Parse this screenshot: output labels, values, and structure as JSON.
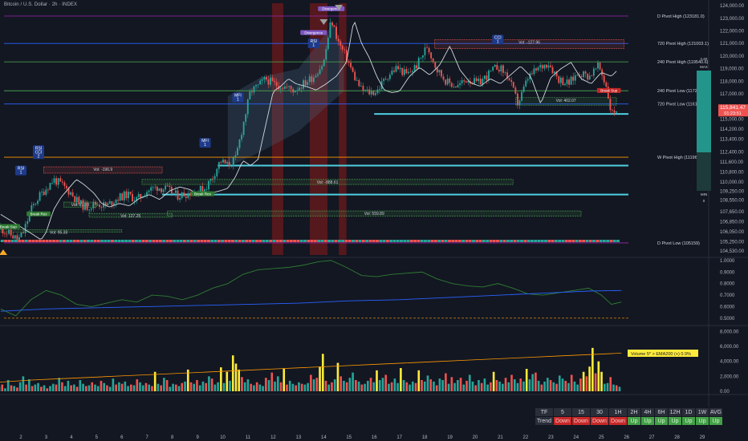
{
  "header": {
    "title": "Bitcoin / U.S. Dollar · 2h · INDEX"
  },
  "chart_data": [
    {
      "type": "candlestick",
      "panel": "price",
      "ylim": [
        104200,
        124200
      ],
      "y_ticks": [
        124000,
        123000,
        122000,
        121000,
        120000,
        119000,
        118000,
        117000,
        116000,
        115000,
        114200,
        113400,
        112400,
        111600,
        110800,
        110000,
        109250,
        108550,
        107650,
        106850,
        106050,
        105250,
        104530
      ],
      "y_tick_labels": [
        "124,000.00",
        "123,000.00",
        "122,000.00",
        "121,000.00",
        "120,000.00",
        "119,000.00",
        "118,000.00",
        "117,000.00",
        "116,000.00",
        "115,000.00",
        "114,200.00",
        "113,400.00",
        "112,400.00",
        "111,600.00",
        "110,800.00",
        "110,000.00",
        "109,250.00",
        "108,550.00",
        "107,650.00",
        "106,850.00",
        "106,050.00",
        "105,250.00",
        "104,530.00"
      ],
      "x_ticks": [
        2,
        3,
        4,
        5,
        6,
        7,
        8,
        9,
        10,
        11,
        12,
        13,
        14,
        15,
        16,
        17,
        18,
        19,
        20,
        21,
        22,
        23,
        24,
        25,
        26,
        27,
        28,
        29
      ],
      "x_tick_labels": [
        "2",
        "3",
        "4",
        "5",
        "6",
        "7",
        "8",
        "9",
        "10",
        "11",
        "12",
        "13",
        "14",
        "15",
        "16",
        "17",
        "18",
        "19",
        "20",
        "21",
        "22",
        "23",
        "24",
        "25",
        "26",
        "27",
        "28",
        "29"
      ],
      "close_path": [
        [
          1.2,
          106300
        ],
        [
          1.6,
          105800
        ],
        [
          1.9,
          105400
        ],
        [
          2.1,
          106000
        ],
        [
          2.4,
          107800
        ],
        [
          2.7,
          108800
        ],
        [
          3.0,
          109500
        ],
        [
          3.3,
          110200
        ],
        [
          3.6,
          109800
        ],
        [
          4.0,
          109100
        ],
        [
          4.3,
          108300
        ],
        [
          4.6,
          108000
        ],
        [
          5.0,
          108300
        ],
        [
          5.4,
          108100
        ],
        [
          5.8,
          108700
        ],
        [
          6.2,
          109000
        ],
        [
          6.6,
          108600
        ],
        [
          7.0,
          109300
        ],
        [
          7.4,
          109600
        ],
        [
          7.8,
          109400
        ],
        [
          8.2,
          108900
        ],
        [
          8.6,
          109100
        ],
        [
          9.0,
          109300
        ],
        [
          9.3,
          109500
        ],
        [
          9.6,
          110400
        ],
        [
          9.9,
          111700
        ],
        [
          10.2,
          111300
        ],
        [
          10.5,
          111800
        ],
        [
          10.8,
          114500
        ],
        [
          11.1,
          117200
        ],
        [
          11.4,
          117600
        ],
        [
          11.7,
          118200
        ],
        [
          12.0,
          117800
        ],
        [
          12.4,
          117600
        ],
        [
          12.8,
          117300
        ],
        [
          13.2,
          117800
        ],
        [
          13.6,
          118400
        ],
        [
          14.0,
          119500
        ],
        [
          14.3,
          122900
        ],
        [
          14.6,
          121000
        ],
        [
          14.9,
          119900
        ],
        [
          15.2,
          118400
        ],
        [
          15.5,
          117300
        ],
        [
          15.8,
          117100
        ],
        [
          16.1,
          117200
        ],
        [
          16.5,
          118400
        ],
        [
          16.9,
          119100
        ],
        [
          17.3,
          118500
        ],
        [
          17.7,
          119300
        ],
        [
          18.1,
          120800
        ],
        [
          18.5,
          118900
        ],
        [
          18.9,
          117900
        ],
        [
          19.3,
          117600
        ],
        [
          19.7,
          118200
        ],
        [
          20.1,
          117800
        ],
        [
          20.5,
          118500
        ],
        [
          20.9,
          119200
        ],
        [
          21.3,
          118400
        ],
        [
          21.7,
          116200
        ],
        [
          22.1,
          118300
        ],
        [
          22.5,
          119000
        ],
        [
          22.9,
          119500
        ],
        [
          23.3,
          118200
        ],
        [
          23.7,
          117800
        ],
        [
          24.1,
          118700
        ],
        [
          24.5,
          118400
        ],
        [
          24.9,
          119200
        ],
        [
          25.2,
          117600
        ],
        [
          25.4,
          115400
        ],
        [
          25.6,
          115800
        ]
      ],
      "last_price": 115841.47,
      "countdown": "01:23:51",
      "levels": [
        {
          "price": 123181.0,
          "label": "D Pivot High (123181.0)",
          "color": "#9c27b0"
        },
        {
          "price": 121003.1,
          "label": "720 Pivot High (121003.1)",
          "color": "#2962ff"
        },
        {
          "price": 119540.6,
          "label": "240 Pivot High (119540.6)",
          "color": "#4caf50"
        },
        {
          "price": 117246.9,
          "label": "240 Pivot Low (117246.9)",
          "color": "#4caf50"
        },
        {
          "price": 116195.3,
          "label": "720 Pivot Low (116195.3)",
          "color": "#2962ff"
        },
        {
          "price": 111965.8,
          "label": "W Pivot High (111965.8)",
          "color": "#ff9800"
        },
        {
          "price": 105159.0,
          "label": "D Pivot Low (105159)",
          "color": "#9c27b0"
        }
      ],
      "cyan_lines": [
        111300,
        109000,
        115400
      ],
      "volume_boxes": [
        {
          "label": "Vol: -127.96",
          "color": "#ef5350"
        },
        {
          "label": "Vol: 402.07",
          "color": "#4caf50"
        },
        {
          "label": "Vol: -196.9",
          "color": "#ef5350"
        },
        {
          "label": "Vol: -888.61",
          "color": "#4caf50"
        },
        {
          "label": "Vol: 127.25",
          "color": "#4caf50"
        },
        {
          "label": "Vol: 559.89",
          "color": "#4caf50"
        },
        {
          "label": "Vol: 97.58",
          "color": "#4caf50"
        },
        {
          "label": "Vol: 95.33",
          "color": "#4caf50"
        }
      ],
      "signals": [
        {
          "x": 2.0,
          "price": 110400,
          "label": "RSI\n1",
          "color": "#1e3a8a"
        },
        {
          "x": 2.7,
          "price": 111700,
          "label": "RSI\nCCI\n2",
          "color": "#1e3a8a"
        },
        {
          "x": 10.6,
          "price": 116200,
          "label": "MFI\n1",
          "color": "#1e3a8a"
        },
        {
          "x": 9.3,
          "price": 112600,
          "label": "MFI\n1",
          "color": "#1e3a8a"
        },
        {
          "x": 13.6,
          "price": 120500,
          "label": "RSI\n1",
          "color": "#1e3a8a"
        },
        {
          "x": 20.9,
          "price": 120800,
          "label": "CCI\n1",
          "color": "#1e3a8a"
        }
      ],
      "tags": [
        "Break Sup",
        "Break Res",
        "Break Res",
        "Break Sup",
        "Divergence",
        "Divergence"
      ],
      "side_labels": {
        "max": "MAX",
        "min": "MIN",
        "zero": "0",
        "max_value": "4.4K"
      }
    },
    {
      "type": "line",
      "panel": "oscillator",
      "ylim": [
        0.45,
        1.02
      ],
      "y_ticks": [
        1.0,
        0.9,
        0.8,
        0.7,
        0.6,
        0.5
      ],
      "y_tick_labels": [
        "1.0000",
        "0.9000",
        "0.8000",
        "0.7000",
        "0.6000",
        "0.5000"
      ],
      "series": [
        {
          "color": "#2e7d32",
          "values": [
            [
              1.2,
              0.58
            ],
            [
              1.8,
              0.52
            ],
            [
              2.4,
              0.66
            ],
            [
              3.0,
              0.74
            ],
            [
              3.6,
              0.7
            ],
            [
              4.2,
              0.62
            ],
            [
              4.8,
              0.6
            ],
            [
              5.4,
              0.63
            ],
            [
              6.0,
              0.66
            ],
            [
              6.6,
              0.64
            ],
            [
              7.2,
              0.7
            ],
            [
              7.8,
              0.69
            ],
            [
              8.4,
              0.66
            ],
            [
              9.0,
              0.7
            ],
            [
              9.6,
              0.76
            ],
            [
              10.2,
              0.8
            ],
            [
              10.8,
              0.88
            ],
            [
              11.4,
              0.92
            ],
            [
              12.0,
              0.93
            ],
            [
              12.6,
              0.94
            ],
            [
              13.2,
              0.96
            ],
            [
              13.8,
              0.99
            ],
            [
              14.3,
              1.0
            ],
            [
              14.9,
              0.94
            ],
            [
              15.5,
              0.87
            ],
            [
              16.1,
              0.86
            ],
            [
              16.7,
              0.88
            ],
            [
              17.3,
              0.89
            ],
            [
              17.9,
              0.9
            ],
            [
              18.5,
              0.84
            ],
            [
              19.1,
              0.8
            ],
            [
              19.7,
              0.78
            ],
            [
              20.3,
              0.77
            ],
            [
              20.9,
              0.8
            ],
            [
              21.5,
              0.76
            ],
            [
              22.1,
              0.71
            ],
            [
              22.7,
              0.7
            ],
            [
              23.3,
              0.72
            ],
            [
              23.9,
              0.74
            ],
            [
              24.5,
              0.76
            ],
            [
              25.0,
              0.7
            ],
            [
              25.4,
              0.62
            ],
            [
              25.8,
              0.64
            ]
          ]
        },
        {
          "color": "#2962ff",
          "values": [
            [
              1.2,
              0.56
            ],
            [
              3.0,
              0.58
            ],
            [
              5.0,
              0.59
            ],
            [
              7.0,
              0.6
            ],
            [
              9.0,
              0.61
            ],
            [
              11.0,
              0.62
            ],
            [
              13.0,
              0.63
            ],
            [
              15.0,
              0.65
            ],
            [
              17.0,
              0.66
            ],
            [
              19.0,
              0.68
            ],
            [
              21.0,
              0.7
            ],
            [
              23.0,
              0.72
            ],
            [
              24.5,
              0.735
            ],
            [
              25.8,
              0.74
            ]
          ]
        }
      ],
      "reference_line": 0.5
    },
    {
      "type": "bar",
      "panel": "volume",
      "ylim": [
        0,
        7500
      ],
      "y_ticks": [
        8000,
        6000,
        4000,
        2000,
        0
      ],
      "y_tick_labels": [
        "8,000.00",
        "6,000.00",
        "4,000.00",
        "2,000.00",
        "0.00"
      ],
      "label": "Volume 5* > EMA200 (+) 0.9%",
      "values": [
        600,
        900,
        400,
        1500,
        800,
        700,
        500,
        1200,
        2000,
        900,
        1600,
        700,
        900,
        1100,
        600,
        800,
        400,
        700,
        1000,
        900,
        1800,
        1200,
        700,
        1400,
        800,
        900,
        600,
        1500,
        1000,
        700,
        800,
        1200,
        900,
        700,
        1400,
        1100,
        800,
        600,
        1700,
        900,
        1200,
        1000,
        1300,
        700,
        900,
        800,
        1600,
        1200,
        800,
        1100,
        900,
        700,
        2600,
        1000,
        800,
        1800,
        1500,
        600,
        1000,
        900,
        700,
        1100,
        1300,
        2900,
        1200,
        1000,
        1500,
        800,
        1300,
        1100,
        2000,
        1700,
        900,
        1200,
        3200,
        1100,
        2600,
        1400,
        4800,
        3700,
        2900,
        1900,
        1200,
        1600,
        1000,
        800,
        1200,
        900,
        700,
        1800,
        1500,
        2500,
        1300,
        2000,
        1200,
        3000,
        900,
        1400,
        1000,
        800,
        1200,
        1000,
        900,
        1100,
        2200,
        1600,
        1800,
        3300,
        5000,
        1400,
        900,
        1200,
        1600,
        3800,
        2000,
        1400,
        1200,
        1800,
        2500,
        1500,
        1300,
        900,
        1000,
        1400,
        1800,
        1200,
        2800,
        1500,
        1800,
        2200,
        1000,
        1200,
        1700,
        1100,
        3100,
        1500,
        1200,
        900,
        1300,
        1100,
        2800,
        1500,
        1300,
        2100,
        1600,
        1300,
        800,
        1700,
        1500,
        2400,
        1000,
        1900,
        1100,
        1500,
        1800,
        900,
        1400,
        2200,
        1300,
        800,
        1500,
        1100,
        1700,
        900,
        1200,
        2600,
        1500,
        1300,
        1000,
        1800,
        1200,
        2200,
        1600,
        1100,
        1700,
        1300,
        3000,
        1600,
        2300,
        2500,
        1400,
        900,
        1300,
        1800,
        1500,
        1200,
        1000,
        2100,
        1700,
        1400,
        1100,
        2200,
        1300,
        900,
        1700,
        2600,
        2000,
        3300,
        5800,
        2400,
        4000,
        2600,
        1000,
        1100,
        1900,
        900,
        800,
        600
      ],
      "colors_pattern": "alternating by candle direction; yellow highlights for high-volume bars"
    }
  ],
  "trend_table": {
    "header": [
      "TF",
      "5",
      "15",
      "30",
      "1H",
      "2H",
      "4H",
      "6H",
      "12H",
      "1D",
      "1W",
      "AVG"
    ],
    "row_label": "Trend",
    "row": [
      "Down",
      "Down",
      "Down",
      "Down",
      "Up",
      "Up",
      "Up",
      "Up",
      "Up",
      "Up",
      "Up"
    ]
  },
  "colors": {
    "bg": "#131722",
    "up": "#26a69a",
    "down": "#ef5350",
    "highlight": "#ffeb3b",
    "grid": "#1e222d",
    "text": "#b2b5be"
  }
}
